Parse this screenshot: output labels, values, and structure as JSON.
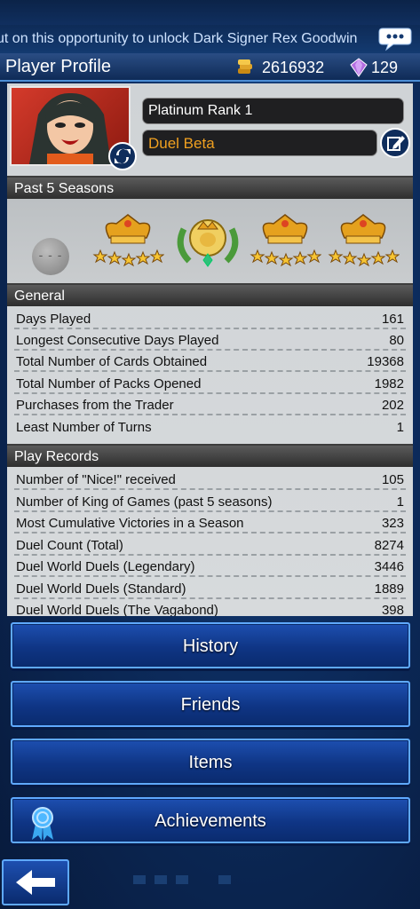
{
  "ticker": {
    "text": "ut on this opportunity to unlock Dark Signer Rex Goodwin"
  },
  "header": {
    "title": "Player Profile",
    "gold": "2616932",
    "gems": "129"
  },
  "profile": {
    "rank": "Platinum Rank 1",
    "title": "Duel Beta"
  },
  "seasons": {
    "heading": "Past 5 Seasons",
    "empty_label": "- - -"
  },
  "general": {
    "heading": "General",
    "rows": [
      {
        "label": "Days Played",
        "value": "161"
      },
      {
        "label": "Longest Consecutive Days Played",
        "value": "80"
      },
      {
        "label": "Total Number of Cards Obtained",
        "value": "19368"
      },
      {
        "label": "Total Number of Packs Opened",
        "value": "1982"
      },
      {
        "label": "Purchases from the Trader",
        "value": "202"
      },
      {
        "label": "Least Number of Turns",
        "value": "1"
      }
    ]
  },
  "play_records": {
    "heading": "Play Records",
    "rows": [
      {
        "label": "Number of \"Nice!\" received",
        "value": "105"
      },
      {
        "label": "Number of King of Games (past 5 seasons)",
        "value": "1"
      },
      {
        "label": "Most Cumulative Victories in a Season",
        "value": "323"
      },
      {
        "label": "Duel Count (Total)",
        "value": "8274"
      },
      {
        "label": "Duel World Duels (Legendary)",
        "value": "3446"
      },
      {
        "label": "Duel World Duels (Standard)",
        "value": "1889"
      },
      {
        "label": "Duel World Duels (The Vagabond)",
        "value": "398"
      }
    ]
  },
  "buttons": {
    "history": "History",
    "friends": "Friends",
    "items": "Items",
    "achievements": "Achievements"
  },
  "colors": {
    "accent": "#5fa9ff",
    "title_orange": "#f0a020",
    "button_blue": "#0f3585"
  }
}
